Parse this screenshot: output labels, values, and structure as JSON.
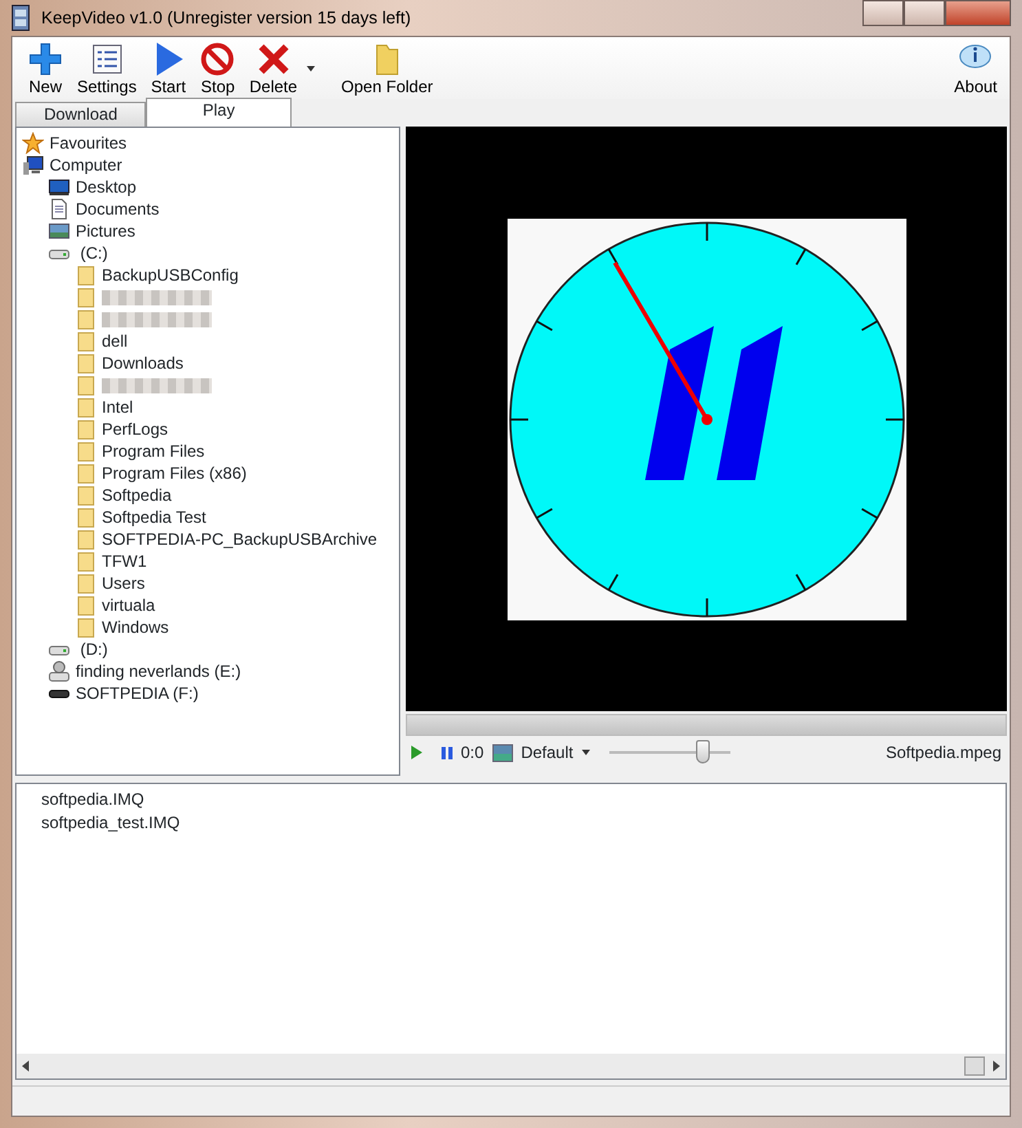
{
  "window": {
    "title": "KeepVideo v1.0 (Unregister version 15 days left)"
  },
  "toolbar": [
    {
      "kind": "new",
      "label": "New"
    },
    {
      "kind": "settings",
      "label": "Settings"
    },
    {
      "kind": "start",
      "label": "Start"
    },
    {
      "kind": "stop",
      "label": "Stop"
    },
    {
      "kind": "delete",
      "label": "Delete"
    },
    {
      "kind": "dropdown"
    },
    {
      "kind": "folder",
      "label": "Open Folder"
    }
  ],
  "about": {
    "label": "About"
  },
  "tabs": [
    {
      "label": "Download",
      "selected": false
    },
    {
      "label": "Play",
      "selected": true
    }
  ],
  "tree": [
    {
      "kind": "star",
      "label": "Favourites"
    },
    {
      "kind": "computer",
      "label": "Computer",
      "children": [
        {
          "kind": "desktop",
          "label": "Desktop"
        },
        {
          "kind": "document",
          "label": "Documents"
        },
        {
          "kind": "picture",
          "label": "Pictures"
        },
        {
          "kind": "drive",
          "label": " (C:)",
          "children": [
            {
              "kind": "folder",
              "label": "BackupUSBConfig"
            },
            {
              "kind": "blurred"
            },
            {
              "kind": "blurred"
            },
            {
              "kind": "folder",
              "label": "dell"
            },
            {
              "kind": "folder",
              "label": "Downloads"
            },
            {
              "kind": "blurred"
            },
            {
              "kind": "folder",
              "label": "Intel"
            },
            {
              "kind": "folder",
              "label": "PerfLogs"
            },
            {
              "kind": "folder",
              "label": "Program Files"
            },
            {
              "kind": "folder",
              "label": "Program Files (x86)"
            },
            {
              "kind": "folder",
              "label": "Softpedia"
            },
            {
              "kind": "folder",
              "label": "Softpedia Test"
            },
            {
              "kind": "folder",
              "label": "SOFTPEDIA-PC_BackupUSBArchive"
            },
            {
              "kind": "folder",
              "label": "TFW1"
            },
            {
              "kind": "folder",
              "label": "Users"
            },
            {
              "kind": "folder",
              "label": "virtuala"
            },
            {
              "kind": "folder",
              "label": "Windows"
            }
          ]
        },
        {
          "kind": "drive",
          "label": " (D:)"
        },
        {
          "kind": "netdrive",
          "label": "finding neverlands (E:)"
        },
        {
          "kind": "removable",
          "label": "SOFTPEDIA (F:)"
        }
      ]
    }
  ],
  "player": {
    "time": "0:0",
    "aspect": "Default",
    "volume": {
      "level": 0.78
    },
    "file": "Softpedia.mpeg"
  },
  "files": [
    "softpedia.IMQ",
    "softpedia_test.IMQ"
  ]
}
